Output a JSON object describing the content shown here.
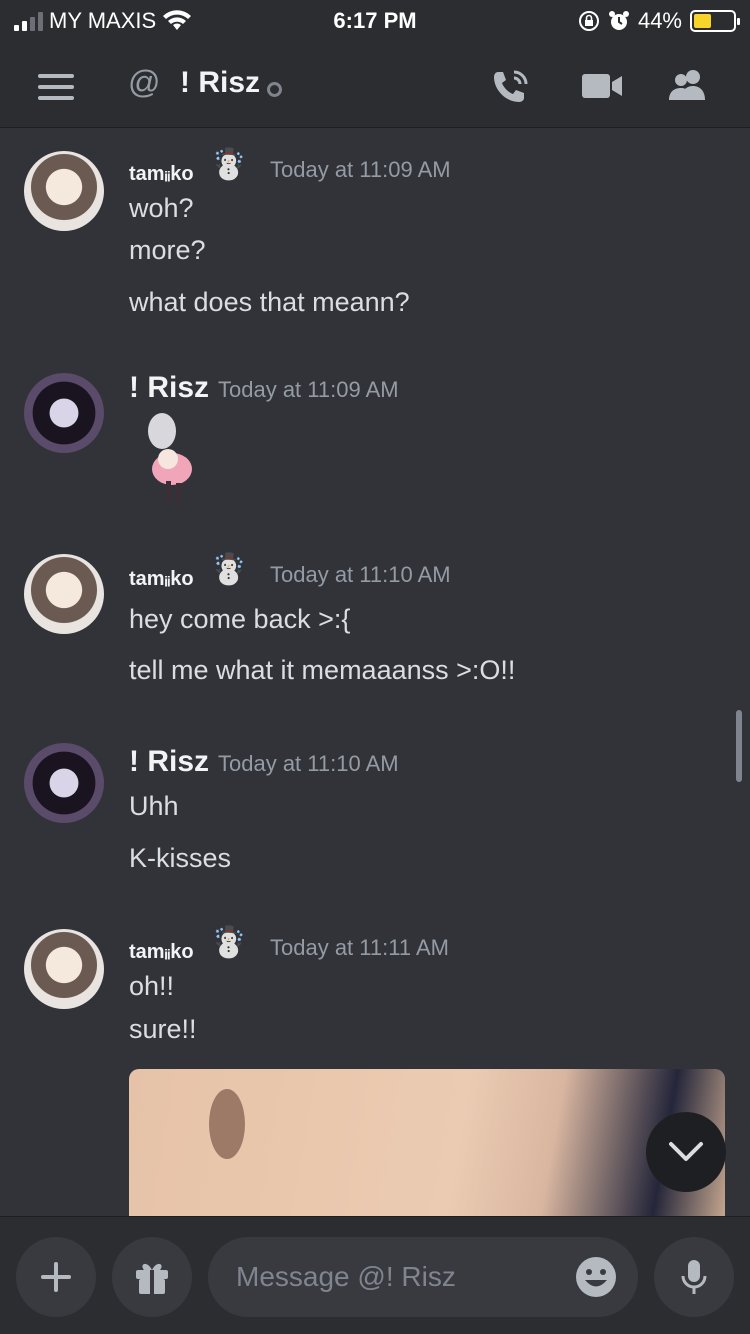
{
  "status_bar": {
    "carrier": "MY MAXIS",
    "time": "6:17 PM",
    "battery": "44%",
    "battery_level": 0.44
  },
  "header": {
    "channel_name": "! Risz"
  },
  "messages": [
    {
      "author": "tamᵢᵢko",
      "badge": "☃️",
      "timestamp": "Today at 11:09 AM",
      "lines": [
        "woh?",
        "more?",
        "what does that meann?"
      ]
    },
    {
      "author": "! Risz",
      "timestamp": "Today at 11:09 AM",
      "lines": []
    },
    {
      "author": "tamᵢᵢko",
      "badge": "☃️",
      "timestamp": "Today at 11:10 AM",
      "lines": [
        "hey come back >:{",
        "tell me what it memaaanss >:O!!"
      ]
    },
    {
      "author": "! Risz",
      "timestamp": "Today at 11:10 AM",
      "lines": [
        "Uhh",
        "K-kisses"
      ]
    },
    {
      "author": "tamᵢᵢko",
      "badge": "☃️",
      "timestamp": "Today at 11:11 AM",
      "lines": [
        "oh!!",
        "sure!!"
      ]
    }
  ],
  "composer": {
    "placeholder": "Message @! Risz"
  },
  "colors": {
    "background": "#313338",
    "header": "#2b2d31",
    "muted": "#949ba4",
    "text": "#dbdee1"
  }
}
